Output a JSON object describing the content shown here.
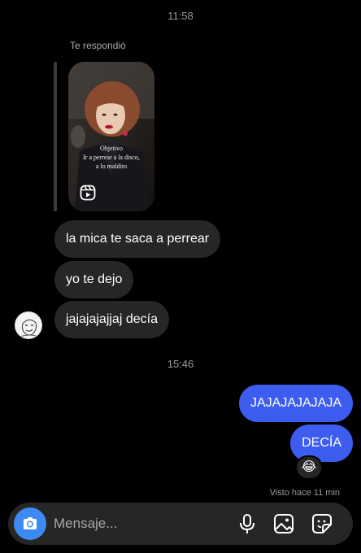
{
  "chat": {
    "timestamp_1": "11:58",
    "reply_label": "Te respondió",
    "reel": {
      "caption_line1": "Objetivo",
      "caption_line2": "Ir a perrear a la disco,",
      "caption_line3": "a lo maldito",
      "icon": "reels-icon"
    },
    "incoming": [
      "la mica te saca a perrear",
      "yo te dejo",
      "jajajajajjaj decía"
    ],
    "timestamp_2": "15:46",
    "outgoing": [
      "JAJAJAJAJAJA",
      "DECÍA"
    ],
    "reaction_emoji": "😂",
    "seen_status": "Visto hace 11 min"
  },
  "composer": {
    "placeholder": "Mensaje...",
    "icons": [
      "camera-icon",
      "microphone-icon",
      "gallery-icon",
      "sticker-icon"
    ],
    "camera_color": "#3d8bf2"
  },
  "colors": {
    "background": "#000000",
    "incoming_bubble": "#262626",
    "outgoing_bubble": "#3d5cf0"
  }
}
